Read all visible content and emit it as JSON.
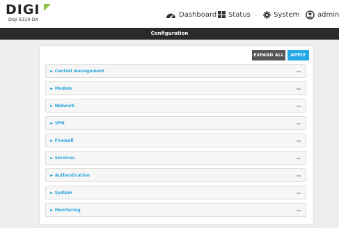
{
  "header": {
    "logo_text": "DIGI",
    "device_name": "Digi 6310-DX",
    "nav": {
      "dashboard": "Dashboard",
      "status": "Status",
      "system": "System",
      "admin": "admin"
    }
  },
  "titlebar": {
    "title": "Configuration"
  },
  "toolbar": {
    "expand_all": "EXPAND ALL",
    "apply": "APPLY"
  },
  "sections": [
    {
      "label": "► Central management"
    },
    {
      "label": "► Modem"
    },
    {
      "label": "► Network"
    },
    {
      "label": "► VPN"
    },
    {
      "label": "► Firewall"
    },
    {
      "label": "► Services"
    },
    {
      "label": "► Authentication"
    },
    {
      "label": "► System"
    },
    {
      "label": "► Monitoring"
    }
  ],
  "colors": {
    "brand_green": "#86c440",
    "accent_blue": "#27a9e9",
    "titlebar": "#2a2a2a"
  }
}
